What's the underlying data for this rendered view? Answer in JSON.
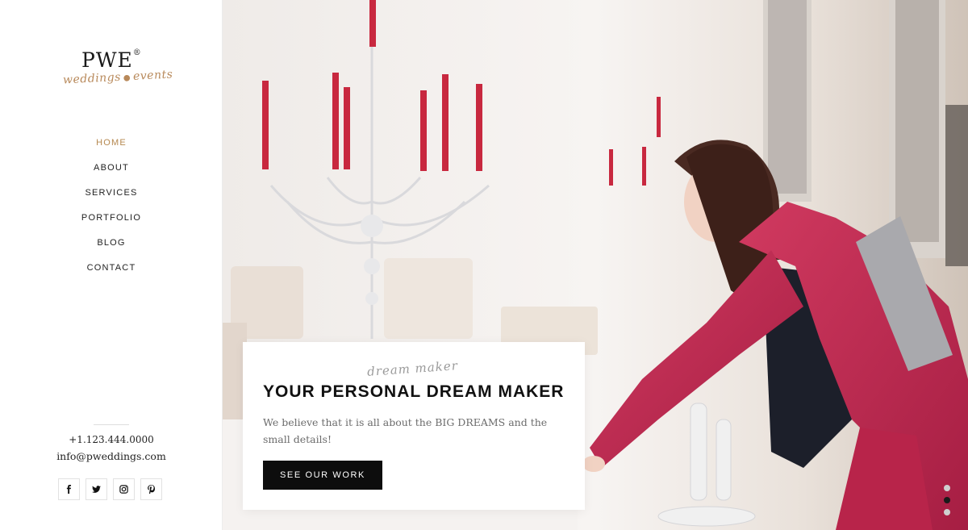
{
  "brand": {
    "mark": "PWE",
    "registered": "®",
    "script_left": "weddings",
    "script_right": "events",
    "accent_color": "#b5884f"
  },
  "nav": {
    "items": [
      {
        "label": "HOME",
        "active": true
      },
      {
        "label": "ABOUT",
        "active": false
      },
      {
        "label": "SERVICES",
        "active": false
      },
      {
        "label": "PORTFOLIO",
        "active": false
      },
      {
        "label": "BLOG",
        "active": false
      },
      {
        "label": "CONTACT",
        "active": false
      }
    ]
  },
  "contact": {
    "phone": "+1.123.444.0000",
    "email": "info@pweddings.com"
  },
  "socials": [
    {
      "icon": "facebook-icon"
    },
    {
      "icon": "twitter-icon"
    },
    {
      "icon": "instagram-icon"
    },
    {
      "icon": "pinterest-icon"
    }
  ],
  "hero": {
    "script": "dream maker",
    "title": "YOUR PERSONAL DREAM MAKER",
    "text": "We believe that it is all about the BIG DREAMS and the small details!",
    "button_label": "SEE OUR WORK",
    "slides_total": 3,
    "active_slide": 2,
    "colors": {
      "suit": "#c42a52",
      "candle": "#c8283f",
      "top": "#1c1f2a"
    }
  }
}
